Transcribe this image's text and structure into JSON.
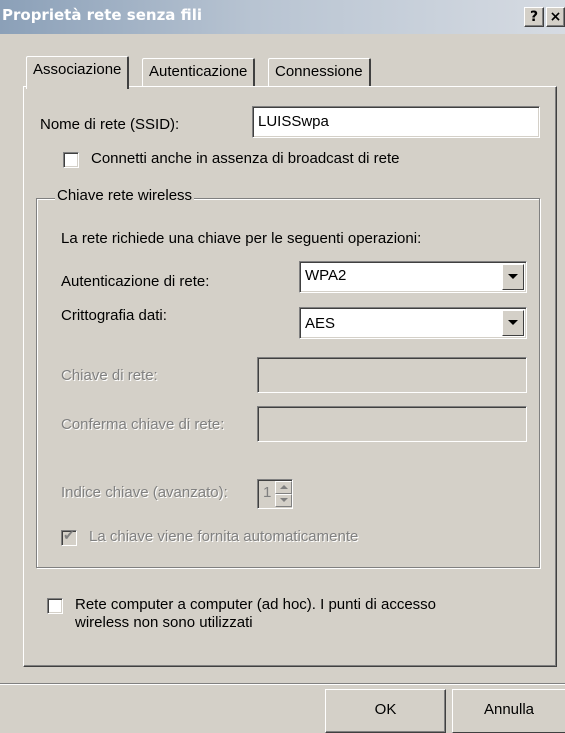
{
  "window": {
    "title": "Proprietà rete senza fili",
    "help_label": "?",
    "close_label": "×"
  },
  "tabs": [
    {
      "label": "Associazione",
      "active": true
    },
    {
      "label": "Autenticazione",
      "active": false
    },
    {
      "label": "Connessione",
      "active": false
    }
  ],
  "association": {
    "ssid_label": "Nome di rete (SSID):",
    "ssid_value": "LUISSwpa",
    "broadcast_checkbox": {
      "label": "Connetti anche in assenza di broadcast di rete",
      "checked": false
    },
    "group_title": "Chiave rete wireless",
    "group_intro": "La rete richiede una chiave per le seguenti operazioni:",
    "auth_label": "Autenticazione di rete:",
    "auth_value": "WPA2",
    "encryption_label": "Crittografia dati:",
    "encryption_value": "AES",
    "network_key_label": "Chiave di rete:",
    "network_key_value": "",
    "confirm_key_label": "Conferma chiave di rete:",
    "confirm_key_value": "",
    "key_index_label": "Indice chiave (avanzato):",
    "key_index_value": "1",
    "auto_key_checkbox": {
      "label": "La chiave viene fornita automaticamente",
      "checked": true,
      "enabled": false
    },
    "adhoc_checkbox": {
      "label_line1": "Rete computer a computer (ad hoc). I punti di accesso",
      "label_line2": "wireless non sono utilizzati",
      "checked": false
    }
  },
  "buttons": {
    "ok": "OK",
    "cancel": "Annulla"
  }
}
